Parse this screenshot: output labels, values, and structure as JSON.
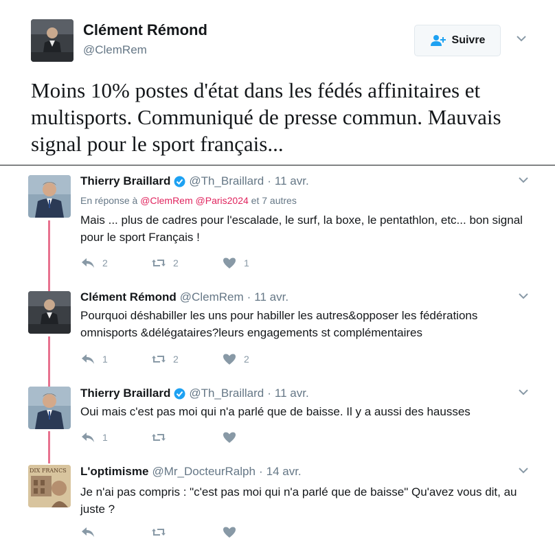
{
  "main_tweet": {
    "author_name": "Clément Rémond",
    "author_handle": "@ClemRem",
    "follow_label": "Suivre",
    "text": "Moins 10% postes d'état dans les fédés affinitaires et multisports. Communiqué de presse commun. Mauvais signal pour le sport français..."
  },
  "replies": [
    {
      "name": "Thierry Braillard",
      "verified": true,
      "handle": "@Th_Braillard",
      "time": "11 avr.",
      "in_reply_prefix": "En réponse à",
      "in_reply_mentions": "@ClemRem @Paris2024",
      "in_reply_suffix": "et 7 autres",
      "text": "Mais ... plus de cadres pour l'escalade, le surf, la boxe, le pentathlon, etc... bon signal pour le sport Français !",
      "replies_count": "2",
      "retweets_count": "2",
      "likes_count": "1"
    },
    {
      "name": "Clément Rémond",
      "verified": false,
      "handle": "@ClemRem",
      "time": "11 avr.",
      "text": "Pourquoi déshabiller les uns pour habiller les autres&opposer les fédérations omnisports &délégataires?leurs engagements st complémentaires",
      "replies_count": "1",
      "retweets_count": "2",
      "likes_count": "2"
    },
    {
      "name": "Thierry Braillard",
      "verified": true,
      "handle": "@Th_Braillard",
      "time": "11 avr.",
      "text": "Oui mais c'est pas moi qui n'a parlé que de baisse. Il y a aussi des hausses",
      "replies_count": "1",
      "retweets_count": "",
      "likes_count": ""
    },
    {
      "name": "L'optimisme",
      "verified": false,
      "handle": "@Mr_DocteurRalph",
      "time": "14 avr.",
      "text": "Je n'ai pas compris : \"c'est pas moi qui n'a parlé que de baisse\" Qu'avez vous dit, au juste ?",
      "avatar_text": "DIX FRANCS",
      "replies_count": "",
      "retweets_count": "",
      "likes_count": ""
    }
  ],
  "sep": "·",
  "colors": {
    "accent": "#1da1f2",
    "mention": "#e0245e",
    "thread_line": "#e8728f",
    "muted": "#657786"
  },
  "icons": [
    "person-add-icon",
    "chevron-down-icon",
    "verified-badge-icon",
    "reply-icon",
    "retweet-icon",
    "heart-icon"
  ]
}
